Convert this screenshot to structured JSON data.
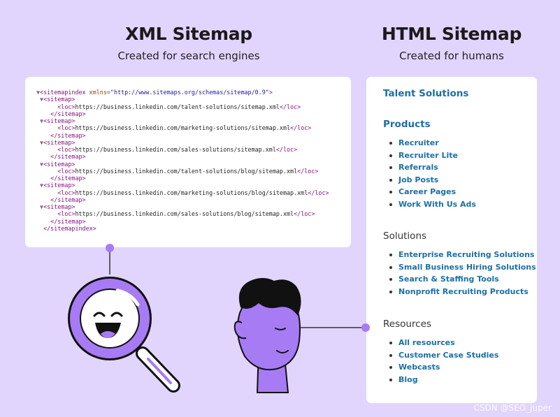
{
  "xml_sitemap": {
    "title": "XML Sitemap",
    "subtitle": "Created for search engines",
    "code_lines": [
      {
        "tri": "▼",
        "indent": "",
        "open": "<sitemapindex",
        "attr": " xmlns=",
        "val": "\"http://www.sitemaps.org/schemas/sitemap/0.9\"",
        "close": ">"
      },
      {
        "tri": " ▼",
        "indent": "",
        "open": "<sitemap>",
        "attr": "",
        "val": "",
        "close": ""
      },
      {
        "tri": "",
        "indent": "      ",
        "open": "<loc>",
        "text": "https://business.linkedin.com/talent-solutions/sitemap.xml",
        "end": "</loc>"
      },
      {
        "tri": "",
        "indent": "    ",
        "open": "</sitemap>"
      },
      {
        "tri": " ▼",
        "indent": "",
        "open": "<sitemap>"
      },
      {
        "tri": "",
        "indent": "      ",
        "open": "<loc>",
        "text": "https://business.linkedin.com/marketing-solutions/sitemap.xml",
        "end": "</loc>"
      },
      {
        "tri": "",
        "indent": "    ",
        "open": "</sitemap>"
      },
      {
        "tri": " ▼",
        "indent": "",
        "open": "<sitemap>"
      },
      {
        "tri": "",
        "indent": "      ",
        "open": "<loc>",
        "text": "https://business.linkedin.com/sales-solutions/sitemap.xml",
        "end": "</loc>"
      },
      {
        "tri": "",
        "indent": "    ",
        "open": "</sitemap>"
      },
      {
        "tri": " ▼",
        "indent": "",
        "open": "<sitemap>"
      },
      {
        "tri": "",
        "indent": "      ",
        "open": "<loc>",
        "text": "https://business.linkedin.com/talent-solutions/blog/sitemap.xml",
        "end": "</loc>"
      },
      {
        "tri": "",
        "indent": "    ",
        "open": "</sitemap>"
      },
      {
        "tri": " ▼",
        "indent": "",
        "open": "<sitemap>"
      },
      {
        "tri": "",
        "indent": "      ",
        "open": "<loc>",
        "text": "https://business.linkedin.com/marketing-solutions/blog/sitemap.xml",
        "end": "</loc>"
      },
      {
        "tri": "",
        "indent": "    ",
        "open": "</sitemap>"
      },
      {
        "tri": " ▼",
        "indent": "",
        "open": "<sitemap>"
      },
      {
        "tri": "",
        "indent": "      ",
        "open": "<loc>",
        "text": "https://business.linkedin.com/sales-solutions/blog/sitemap.xml",
        "end": "</loc>"
      },
      {
        "tri": "",
        "indent": "    ",
        "open": "</sitemap>"
      },
      {
        "tri": "",
        "indent": "  ",
        "open": "</sitemapindex>"
      }
    ]
  },
  "html_sitemap": {
    "title": "HTML Sitemap",
    "subtitle": "Created for humans",
    "sections": [
      {
        "title": "Talent Solutions",
        "style": "link",
        "items": []
      },
      {
        "title": "Products",
        "style": "link",
        "items": [
          "Recruiter",
          "Recruiter Lite",
          "Referrals",
          "Job Posts",
          "Career Pages",
          "Work With Us Ads"
        ]
      },
      {
        "title": "Solutions",
        "style": "plain",
        "items": [
          "Enterprise Recruiting Solutions",
          "Small Business Hiring Solutions",
          "Search & Staffing Tools",
          "Nonprofit Recruiting Products"
        ]
      },
      {
        "title": "Resources",
        "style": "plain",
        "items": [
          "All resources",
          "Customer Case Studies",
          "Webcasts",
          "Blog"
        ]
      }
    ]
  },
  "colors": {
    "background": "#e2d5fd",
    "accent_purple": "#a77bf4",
    "link_blue": "#1d6fa5"
  },
  "watermark": "CSDN @SEO_juper"
}
